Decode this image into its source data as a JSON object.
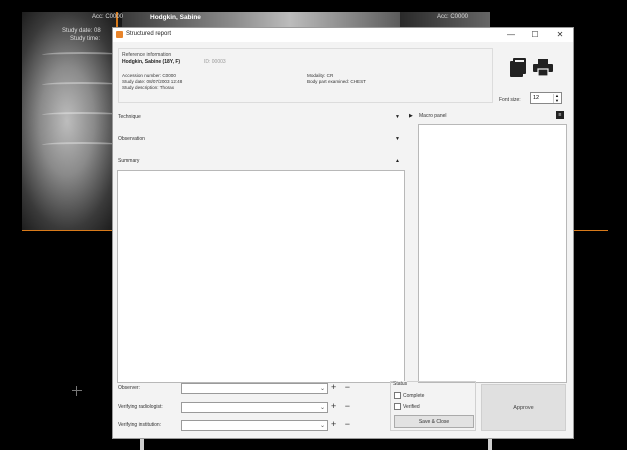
{
  "viewer": {
    "acc_left": "Acc: C0000",
    "acc_right": "Acc: C0000",
    "patient_name": "Hodgkin, Sabine",
    "overlay_lines": [
      "Study date: 08",
      "Study time:"
    ]
  },
  "dialog": {
    "title": "Structured report",
    "window_buttons": {
      "minimize": "—",
      "maximize": "☐",
      "close": "✕"
    },
    "reference": {
      "title": "Reference information",
      "patient": "Hodgkin, Sabine (18Y, F)",
      "id": "ID: 00003",
      "accession": "Accession number: C0000",
      "study_date": "Study date: 08/07/2003 12:48",
      "study_description": "Study description: Thorax",
      "modality": "Modality: CR",
      "body_part": "Body part examined: CHEST"
    },
    "font_size_label": "Font size:",
    "font_size_value": "12",
    "sections": {
      "technique": "Technique",
      "observation": "Observation",
      "summary": "Summary"
    },
    "macro_panel_label": "Macro panel",
    "summary_text": "",
    "fields": {
      "observer_label": "Observer:",
      "observer_value": "",
      "verifying_radiologist_label": "Verifying radiologist:",
      "verifying_radiologist_value": "",
      "verifying_institution_label": "Verifying institution:",
      "verifying_institution_value": ""
    },
    "plus_minus": "+ −",
    "status": {
      "title": "Status",
      "complete_label": "Complete",
      "complete_checked": false,
      "verified_label": "Verified",
      "verified_checked": false
    },
    "save_close_label": "Save & Close",
    "approve_label": "Approve",
    "accent_color": "#e8842a"
  }
}
